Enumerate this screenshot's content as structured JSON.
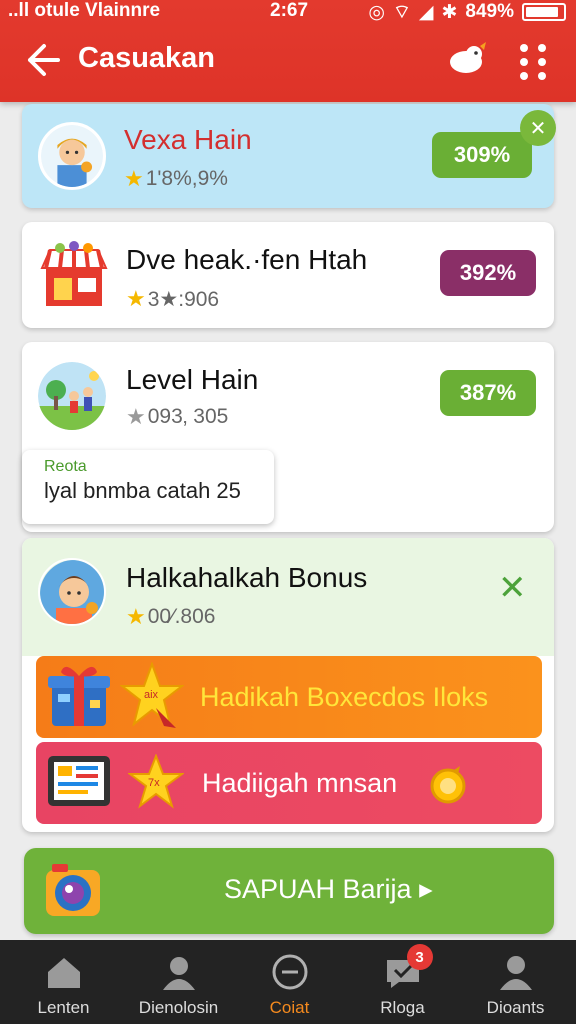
{
  "status_bar": {
    "carrier": "..ll otule Vlainnre",
    "time": "2:67",
    "battery": "849%"
  },
  "app_bar": {
    "title": "Casuakan",
    "back_icon": "arrow-left-icon",
    "mascot_icon": "bird-icon",
    "menu_icon": "grid-dots-icon"
  },
  "cards": [
    {
      "title": "Vexa Hain",
      "rating_text": "1'8%,9%",
      "percent": "309%",
      "title_color": "#d32f2f"
    },
    {
      "title": "Dve heak.·fen Htah",
      "rating_text": "3★:906",
      "percent": "392%"
    },
    {
      "title": "Level Hain",
      "rating_text": "093‚ 305",
      "percent": "387%"
    }
  ],
  "tooltip": {
    "label": "Reota",
    "text": "lyal bnmba catah 25"
  },
  "bonus": {
    "title": "Halkahalkah Bonus",
    "rating_text": "00⁄.806",
    "promos": [
      {
        "label": "Hadikah Boxecdos Iloks",
        "badge_text": "aix"
      },
      {
        "label": "Hadiigah mnsan",
        "badge_text": "7x"
      }
    ]
  },
  "cta": {
    "label": "SAPUAH Barija ▸"
  },
  "bottom_nav": {
    "items": [
      {
        "label": "Lenten",
        "icon": "home-icon"
      },
      {
        "label": "Dienolosin",
        "icon": "person-icon"
      },
      {
        "label": "Coiat",
        "icon": "add-circle-icon",
        "active": true
      },
      {
        "label": "Rloga",
        "icon": "chat-icon",
        "badge": "3"
      },
      {
        "label": "Dioants",
        "icon": "profile-icon"
      }
    ]
  },
  "colors": {
    "app_bar": "#e33a2e",
    "accent_green": "#6aaf35",
    "accent_purple": "#8a2f67",
    "promo_orange": "#f57c18",
    "promo_pink": "#e84463",
    "nav_active": "#f58a1e"
  }
}
